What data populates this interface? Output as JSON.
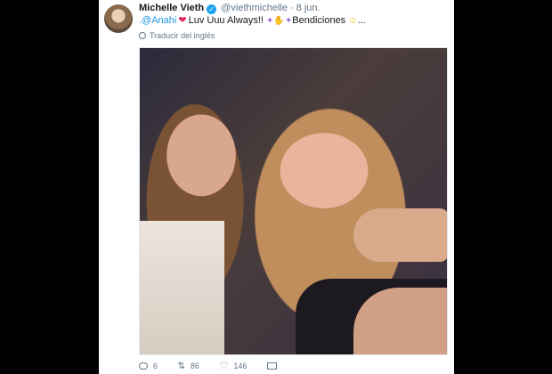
{
  "tweet": {
    "author_name": "Michelle Vieth",
    "author_handle": "@viethmichelle",
    "separator": "·",
    "date": "8 jun.",
    "mention": ".@Anahi",
    "text_main": "Luv Uuu Always!!",
    "text_end": "Bendiciones",
    "ellipsis": "...",
    "translate_label": "Traducir del inglés"
  },
  "actions": {
    "reply_count": "6",
    "retweet_count": "86",
    "like_count": "146"
  },
  "icons": {
    "verified": "verified-badge-icon",
    "heart_emoji": "heart-emoji-icon",
    "sparkles": "sparkles-emoji-icon",
    "praying_hands": "praying-hands-emoji-icon",
    "angel": "angel-emoji-icon",
    "translate": "globe-icon",
    "reply": "reply-icon",
    "retweet": "retweet-icon",
    "like": "like-icon",
    "message": "direct-message-icon"
  },
  "colors": {
    "link": "#1b95e0",
    "verified": "#1da1f2",
    "heart": "#e0245e",
    "muted_text": "#657786",
    "letterbox": "#000000"
  }
}
